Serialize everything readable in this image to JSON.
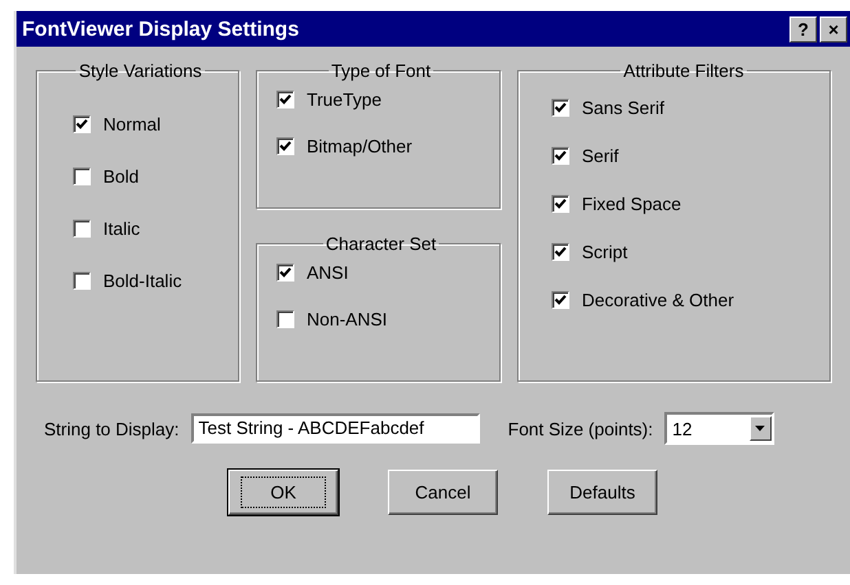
{
  "window": {
    "title": "FontViewer Display Settings",
    "title_buttons": [
      "?",
      "×"
    ]
  },
  "groups": [
    {
      "title": "Style Variations",
      "items": [
        {
          "label": "Normal",
          "checked": true
        },
        {
          "label": "Bold",
          "checked": false
        },
        {
          "label": "Italic",
          "checked": false
        },
        {
          "label": "Bold-Italic",
          "checked": false
        }
      ]
    },
    {
      "title": "Type of Font",
      "items": [
        {
          "label": "TrueType",
          "checked": true
        },
        {
          "label": "Bitmap/Other",
          "checked": true
        }
      ]
    },
    {
      "title": "Character Set",
      "items": [
        {
          "label": "ANSI",
          "checked": true
        },
        {
          "label": "Non-ANSI",
          "checked": false
        }
      ]
    },
    {
      "title": "Attribute Filters",
      "items": [
        {
          "label": "Sans Serif",
          "checked": true
        },
        {
          "label": "Serif",
          "checked": true
        },
        {
          "label": "Fixed Space",
          "checked": true
        },
        {
          "label": "Script",
          "checked": true
        },
        {
          "label": "Decorative & Other",
          "checked": true
        }
      ]
    }
  ],
  "string_field": {
    "label": "String to Display:",
    "value": "Test String - ABCDEFabcdef"
  },
  "font_size": {
    "label": "Font Size (points):",
    "value": "12"
  },
  "buttons": [
    {
      "label": "OK",
      "selected": true
    },
    {
      "label": "Cancel",
      "selected": false
    },
    {
      "label": "Defaults",
      "selected": false
    }
  ]
}
